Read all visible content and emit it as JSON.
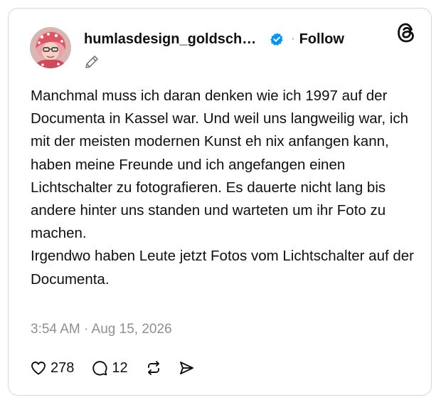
{
  "post": {
    "username": "humlasdesign_goldsch…",
    "separator": "·",
    "follow_label": "Follow",
    "paragraphs": [
      "Manchmal muss ich daran denken wie ich 1997 auf der Documenta in Kassel war. Und weil uns langweilig war, ich mit der meisten modernen Kunst eh nix anfangen kann, haben meine Freunde und ich angefangen einen Lichtschalter zu fotografieren. Es dauerte nicht lang bis andere hinter uns standen und warteten um ihr Foto zu machen.",
      "Irgendwo haben Leute jetzt Fotos vom Lichtschalter auf der Documenta."
    ],
    "timestamp": "3:54 AM · Aug 15, 2026"
  },
  "actions": {
    "like_count": "278",
    "reply_count": "12"
  },
  "icons": {
    "avatar": "avatar-photo",
    "verified": "verified-badge-icon",
    "logo": "threads-logo-icon",
    "edited": "pencil-icon",
    "like": "heart-icon",
    "reply": "comment-bubble-icon",
    "repost": "repost-icon",
    "share": "share-send-icon"
  },
  "colors": {
    "verified_blue": "#0095f6",
    "text_primary": "#101010",
    "text_secondary": "#8f8f8f",
    "border": "#d6d6d6"
  }
}
